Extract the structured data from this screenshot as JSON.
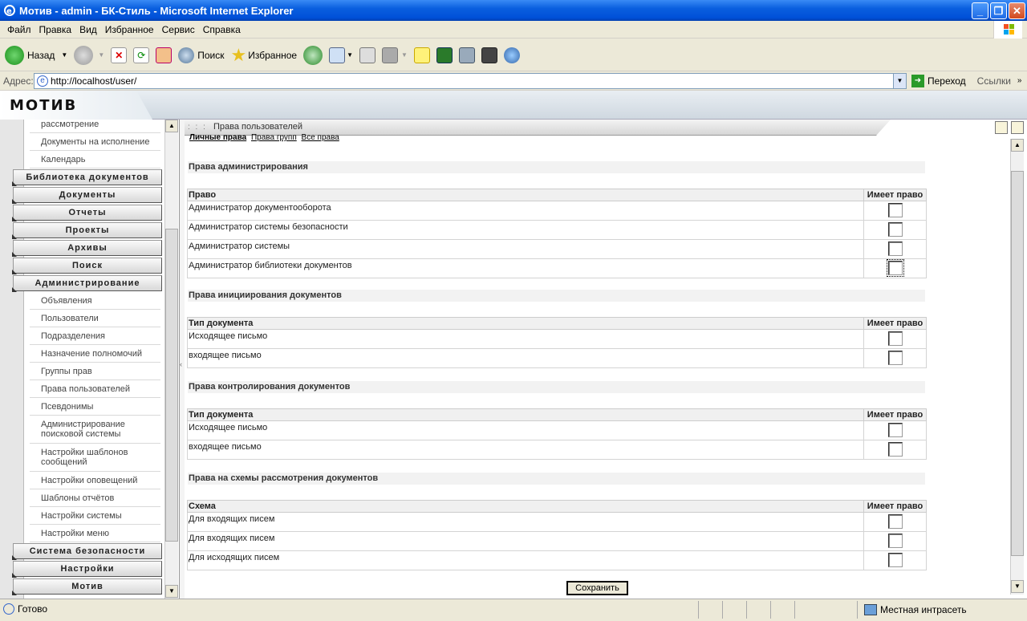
{
  "window": {
    "title": "Мотив - admin - БК-Стиль - Microsoft Internet Explorer"
  },
  "menu": [
    "Файл",
    "Правка",
    "Вид",
    "Избранное",
    "Сервис",
    "Справка"
  ],
  "toolbar": {
    "back": "Назад",
    "search": "Поиск",
    "favorites": "Избранное"
  },
  "address": {
    "label": "Адрес:",
    "url": "http://localhost/user/",
    "go": "Переход",
    "links": "Ссылки"
  },
  "app": {
    "logo": "МОТИВ"
  },
  "sidebar": {
    "top_items": [
      "рассмотрение",
      "Документы на исполнение",
      "Календарь"
    ],
    "categories_top": [
      "Библиотека документов",
      "Документы",
      "Отчеты",
      "Проекты",
      "Архивы",
      "Поиск",
      "Администрирование"
    ],
    "admin_items": [
      "Объявления",
      "Пользователи",
      "Подразделения",
      "Назначение полномочий",
      "Группы прав",
      "Права пользователей",
      "Псевдонимы",
      "Администрирование поисковой системы",
      "Настройки шаблонов сообщений",
      "Настройки оповещений",
      "Шаблоны отчётов",
      "Настройки системы",
      "Настройки меню"
    ],
    "categories_bottom": [
      "Система безопасности",
      "Настройки",
      "Мотив"
    ]
  },
  "tab": {
    "title": "Права пользователей"
  },
  "links_row": [
    "Личные права",
    "Права групп",
    "Все права"
  ],
  "sections": [
    {
      "title": "Права администрирования",
      "col1": "Право",
      "col2": "Имеет право",
      "rows": [
        "Администратор документооборота",
        "Администратор системы безопасности",
        "Администратор системы",
        "Администратор библиотеки документов"
      ]
    },
    {
      "title": "Права инициирования документов",
      "col1": "Тип документа",
      "col2": "Имеет право",
      "rows": [
        "Исходящее письмо",
        "входящее письмо"
      ]
    },
    {
      "title": "Права контролирования документов",
      "col1": "Тип документа",
      "col2": "Имеет право",
      "rows": [
        "Исходящее письмо",
        "входящее письмо"
      ]
    },
    {
      "title": "Права на схемы рассмотрения документов",
      "col1": "Схема",
      "col2": "Имеет право",
      "rows": [
        "Для входящих писем",
        "Для входящих писем",
        "Для исходящих писем"
      ]
    }
  ],
  "save_label": "Сохранить",
  "status": {
    "left": "Готово",
    "zone": "Местная интрасеть"
  }
}
